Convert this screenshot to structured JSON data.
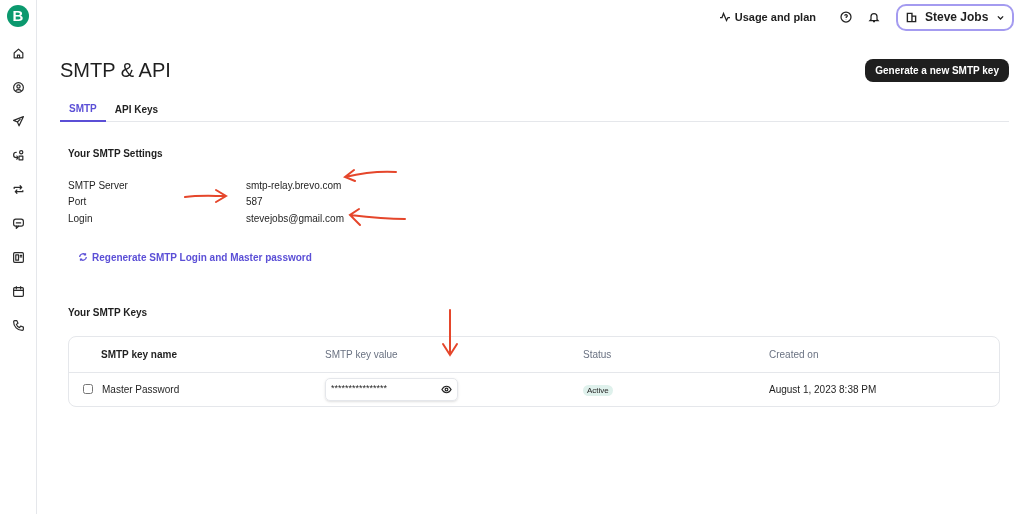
{
  "logo": "B",
  "sidebar": {
    "items": [
      {
        "kind": "home"
      },
      {
        "kind": "contacts"
      },
      {
        "kind": "campaigns"
      },
      {
        "kind": "automations"
      },
      {
        "kind": "transactional"
      },
      {
        "kind": "conversations"
      },
      {
        "kind": "forms"
      },
      {
        "kind": "meetings"
      },
      {
        "kind": "phone"
      }
    ]
  },
  "top_bar": {
    "usage": "Usage and plan",
    "account": "Steve Jobs"
  },
  "page": {
    "title": "SMTP & API",
    "primary_button": "Generate a new SMTP key"
  },
  "tabs": [
    {
      "label": "SMTP",
      "selected": true
    },
    {
      "label": "API Keys",
      "selected": false
    }
  ],
  "settings": {
    "heading": "Your SMTP Settings",
    "rows": [
      {
        "label": "SMTP Server",
        "value": "smtp-relay.brevo.com"
      },
      {
        "label": "Port",
        "value": "587"
      },
      {
        "label": "Login",
        "value": "stevejobs@gmail.com"
      }
    ],
    "link": "Regenerate SMTP Login and Master password"
  },
  "keys": {
    "heading": "Your SMTP Keys",
    "columns": [
      "SMTP key name",
      "SMTP key value",
      "Status",
      "Created on"
    ],
    "rows": [
      {
        "checked": false,
        "name": "Master Password",
        "value": "****************",
        "status": "Active",
        "created": "August 1, 2023 8:38 PM"
      }
    ]
  }
}
